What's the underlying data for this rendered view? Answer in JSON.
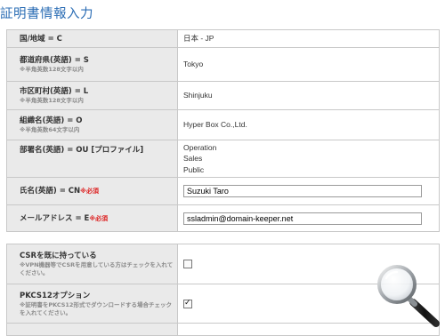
{
  "page": {
    "title": "証明書情報入力"
  },
  "form": {
    "country": {
      "label": "国/地域 = C",
      "value": "日本 - JP"
    },
    "state": {
      "label": "都道府県(英語) = S",
      "note": "※半角英数128文字以内",
      "value": "Tokyo"
    },
    "locality": {
      "label": "市区町村(英語) = L",
      "note": "※半角英数128文字以内",
      "value": "Shinjuku"
    },
    "organization": {
      "label": "組織名(英語) = O",
      "note": "※半角英数64文字以内",
      "value": "Hyper Box Co.,Ltd."
    },
    "org_unit": {
      "label": "部署名(英語) = OU [プロファイル]",
      "values": [
        "Operation",
        "Sales",
        "Public"
      ]
    },
    "common_name": {
      "label": "氏名(英語) = CN",
      "required": "※必須",
      "value": "Suzuki Taro"
    },
    "email": {
      "label": "メールアドレス = E",
      "required": "※必須",
      "value": "ssladmin@domain-keeper.net"
    },
    "csr": {
      "label": "CSRを既に持っている",
      "note": "※VPN機器等でCSRを用意している方はチェックを入れてください。",
      "checked": false
    },
    "pkcs12": {
      "label": "PKCS12オプション",
      "note": "※証明書をPKCS12形式でダウンロードする場合チェックを入れてください。",
      "checked": true
    }
  },
  "icons": {
    "magnifier": "magnifier-icon",
    "check": "checkmark-icon"
  },
  "colors": {
    "title": "#2a6cb4",
    "label_bg": "#eaeaea",
    "required": "#dd2222"
  }
}
